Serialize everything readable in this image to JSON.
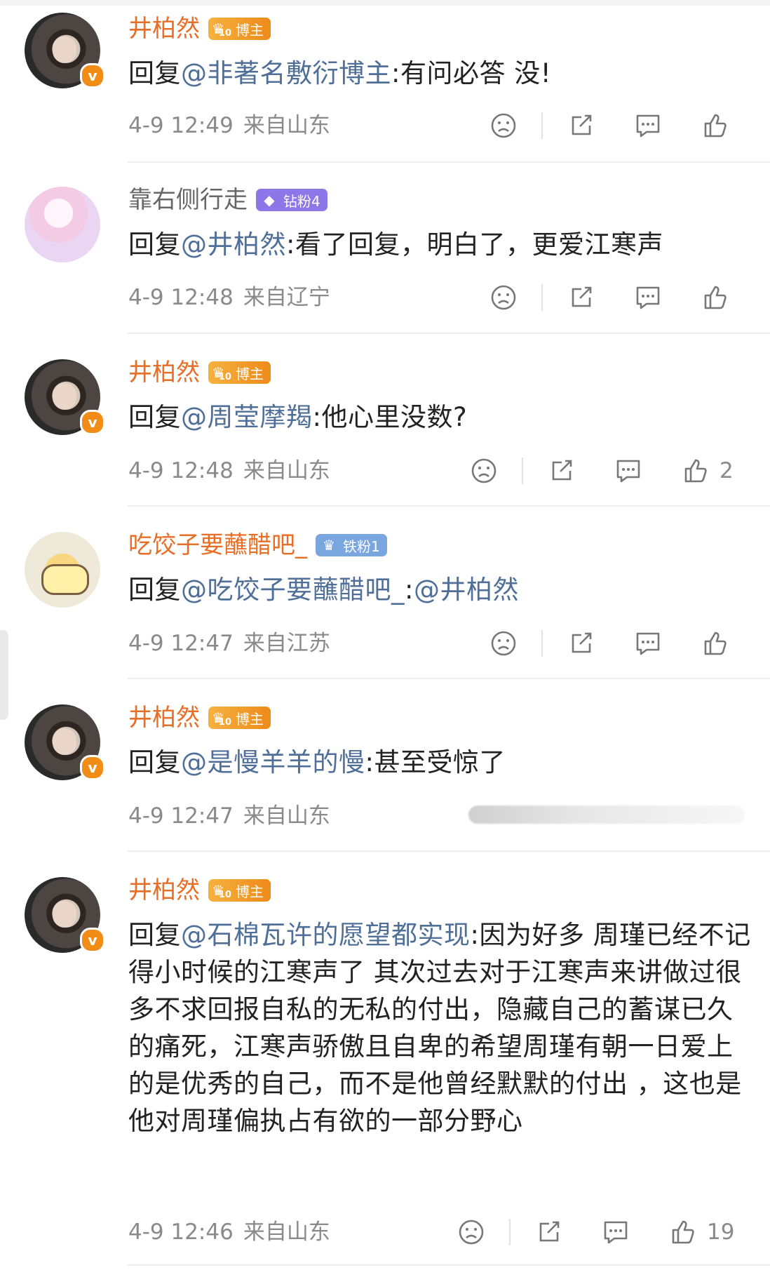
{
  "comments": [
    {
      "user": "井柏然",
      "badge": "博主",
      "prefix": "回复",
      "mention": "@非著名敷衍博主",
      "text": ":有问必答 没!",
      "time": "4-9 12:49",
      "location": "来自山东",
      "likes": ""
    },
    {
      "user": "靠右侧行走",
      "badge": "钻粉4",
      "prefix": "回复",
      "mention": "@井柏然",
      "text": ":看了回复，明白了，更爱江寒声",
      "time": "4-9 12:48",
      "location": "来自辽宁",
      "likes": ""
    },
    {
      "user": "井柏然",
      "badge": "博主",
      "prefix": "回复",
      "mention": "@周莹摩羯",
      "text": ":他心里没数?",
      "time": "4-9 12:48",
      "location": "来自山东",
      "likes": "2"
    },
    {
      "user": "吃饺子要蘸醋吧_",
      "badge": "铁粉1",
      "prefix": "回复",
      "mention": "@吃饺子要蘸醋吧_",
      "text": ":",
      "mention2": "@井柏然",
      "time": "4-9 12:47",
      "location": "来自江苏",
      "likes": ""
    },
    {
      "user": "井柏然",
      "badge": "博主",
      "prefix": "回复",
      "mention": "@是慢羊羊的慢",
      "text": ":甚至受惊了",
      "time": "4-9 12:47",
      "location": "来自山东",
      "likes": ""
    },
    {
      "user": "井柏然",
      "badge": "博主",
      "prefix": "回复",
      "mention": "@石棉瓦许的愿望都实现",
      "text": ":因为好多 周瑾已经不记得小时候的江寒声了 其次过去对于江寒声来讲做过很多不求回报自私的无私的付出，隐藏自己的蓄谋已久的痛死，江寒声骄傲且自卑的希望周瑾有朝一日爱上的是优秀的自己，而不是他曾经默默的付出 ，这也是他对周瑾偏执占有欲的一部分野心",
      "time": "4-9 12:46",
      "location": "来自山东",
      "likes": "19"
    }
  ],
  "icons": {
    "dislike": "unhappy-face-icon",
    "share": "share-icon",
    "comment": "comment-bubble-icon",
    "like": "thumbs-up-icon"
  },
  "badge_crown_level": "10",
  "colors": {
    "name_orange": "#e86d25",
    "mention_blue": "#4f6f98",
    "meta_gray": "#8a8a8a",
    "blogger_badge": "#f19b25",
    "diamond_badge": "#8d76e7",
    "iron_badge": "#7aa6e0"
  }
}
